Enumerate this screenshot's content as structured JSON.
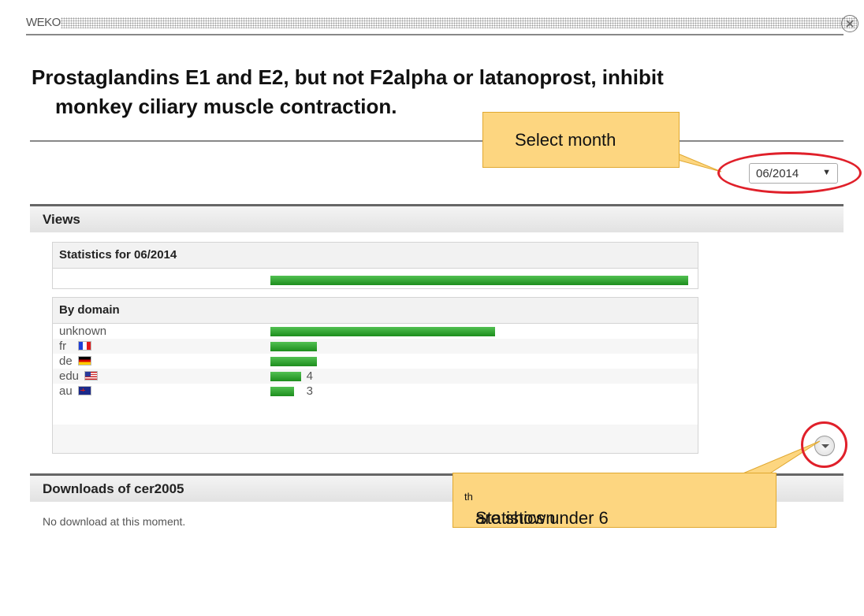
{
  "window": {
    "title": "WEKO",
    "close_icon": "close-icon"
  },
  "item": {
    "title_line1": "Prostaglandins E1 and E2, but not F2alpha or latanoprost, inhibit",
    "title_line2": "monkey ciliary muscle contraction."
  },
  "month_select": {
    "value": "06/2014",
    "arrow": "▼"
  },
  "views": {
    "header": "Views",
    "stats_header": "Statistics for 06/2014",
    "total_count": "54",
    "total_fraction": 1.0,
    "by_domain_header": "By domain",
    "domains": [
      {
        "label": "unknown",
        "count": "29",
        "fraction": 0.537,
        "flag": ""
      },
      {
        "label": "fr",
        "count": "6",
        "fraction": 0.111,
        "flag": "flag-fr"
      },
      {
        "label": "de",
        "count": "6",
        "fraction": 0.111,
        "flag": "flag-de"
      },
      {
        "label": "edu",
        "count": "4",
        "fraction": 0.074,
        "flag": "flag-us"
      },
      {
        "label": "au",
        "count": "3",
        "fraction": 0.056,
        "flag": "flag-au"
      }
    ],
    "expand_icon": "chevron-down-icon"
  },
  "downloads": {
    "header": "Downloads of cer2005",
    "empty_text": "No download at this moment."
  },
  "callouts": {
    "month": "Select month",
    "stats_pre": "Statistics under 6",
    "stats_sup": "th",
    "stats_post": " are shown"
  },
  "colors": {
    "bar": "#2a9a2a",
    "callout": "#fdd680",
    "highlight": "#e0202a"
  }
}
